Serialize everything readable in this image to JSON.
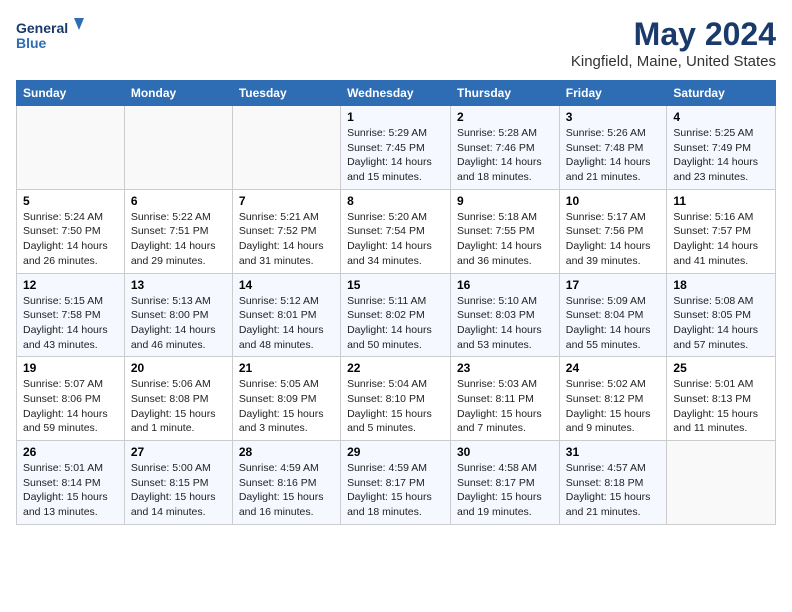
{
  "header": {
    "logo_line1": "General",
    "logo_line2": "Blue",
    "title": "May 2024",
    "subtitle": "Kingfield, Maine, United States"
  },
  "weekdays": [
    "Sunday",
    "Monday",
    "Tuesday",
    "Wednesday",
    "Thursday",
    "Friday",
    "Saturday"
  ],
  "weeks": [
    [
      {
        "day": "",
        "detail": ""
      },
      {
        "day": "",
        "detail": ""
      },
      {
        "day": "",
        "detail": ""
      },
      {
        "day": "1",
        "detail": "Sunrise: 5:29 AM\nSunset: 7:45 PM\nDaylight: 14 hours\nand 15 minutes."
      },
      {
        "day": "2",
        "detail": "Sunrise: 5:28 AM\nSunset: 7:46 PM\nDaylight: 14 hours\nand 18 minutes."
      },
      {
        "day": "3",
        "detail": "Sunrise: 5:26 AM\nSunset: 7:48 PM\nDaylight: 14 hours\nand 21 minutes."
      },
      {
        "day": "4",
        "detail": "Sunrise: 5:25 AM\nSunset: 7:49 PM\nDaylight: 14 hours\nand 23 minutes."
      }
    ],
    [
      {
        "day": "5",
        "detail": "Sunrise: 5:24 AM\nSunset: 7:50 PM\nDaylight: 14 hours\nand 26 minutes."
      },
      {
        "day": "6",
        "detail": "Sunrise: 5:22 AM\nSunset: 7:51 PM\nDaylight: 14 hours\nand 29 minutes."
      },
      {
        "day": "7",
        "detail": "Sunrise: 5:21 AM\nSunset: 7:52 PM\nDaylight: 14 hours\nand 31 minutes."
      },
      {
        "day": "8",
        "detail": "Sunrise: 5:20 AM\nSunset: 7:54 PM\nDaylight: 14 hours\nand 34 minutes."
      },
      {
        "day": "9",
        "detail": "Sunrise: 5:18 AM\nSunset: 7:55 PM\nDaylight: 14 hours\nand 36 minutes."
      },
      {
        "day": "10",
        "detail": "Sunrise: 5:17 AM\nSunset: 7:56 PM\nDaylight: 14 hours\nand 39 minutes."
      },
      {
        "day": "11",
        "detail": "Sunrise: 5:16 AM\nSunset: 7:57 PM\nDaylight: 14 hours\nand 41 minutes."
      }
    ],
    [
      {
        "day": "12",
        "detail": "Sunrise: 5:15 AM\nSunset: 7:58 PM\nDaylight: 14 hours\nand 43 minutes."
      },
      {
        "day": "13",
        "detail": "Sunrise: 5:13 AM\nSunset: 8:00 PM\nDaylight: 14 hours\nand 46 minutes."
      },
      {
        "day": "14",
        "detail": "Sunrise: 5:12 AM\nSunset: 8:01 PM\nDaylight: 14 hours\nand 48 minutes."
      },
      {
        "day": "15",
        "detail": "Sunrise: 5:11 AM\nSunset: 8:02 PM\nDaylight: 14 hours\nand 50 minutes."
      },
      {
        "day": "16",
        "detail": "Sunrise: 5:10 AM\nSunset: 8:03 PM\nDaylight: 14 hours\nand 53 minutes."
      },
      {
        "day": "17",
        "detail": "Sunrise: 5:09 AM\nSunset: 8:04 PM\nDaylight: 14 hours\nand 55 minutes."
      },
      {
        "day": "18",
        "detail": "Sunrise: 5:08 AM\nSunset: 8:05 PM\nDaylight: 14 hours\nand 57 minutes."
      }
    ],
    [
      {
        "day": "19",
        "detail": "Sunrise: 5:07 AM\nSunset: 8:06 PM\nDaylight: 14 hours\nand 59 minutes."
      },
      {
        "day": "20",
        "detail": "Sunrise: 5:06 AM\nSunset: 8:08 PM\nDaylight: 15 hours\nand 1 minute."
      },
      {
        "day": "21",
        "detail": "Sunrise: 5:05 AM\nSunset: 8:09 PM\nDaylight: 15 hours\nand 3 minutes."
      },
      {
        "day": "22",
        "detail": "Sunrise: 5:04 AM\nSunset: 8:10 PM\nDaylight: 15 hours\nand 5 minutes."
      },
      {
        "day": "23",
        "detail": "Sunrise: 5:03 AM\nSunset: 8:11 PM\nDaylight: 15 hours\nand 7 minutes."
      },
      {
        "day": "24",
        "detail": "Sunrise: 5:02 AM\nSunset: 8:12 PM\nDaylight: 15 hours\nand 9 minutes."
      },
      {
        "day": "25",
        "detail": "Sunrise: 5:01 AM\nSunset: 8:13 PM\nDaylight: 15 hours\nand 11 minutes."
      }
    ],
    [
      {
        "day": "26",
        "detail": "Sunrise: 5:01 AM\nSunset: 8:14 PM\nDaylight: 15 hours\nand 13 minutes."
      },
      {
        "day": "27",
        "detail": "Sunrise: 5:00 AM\nSunset: 8:15 PM\nDaylight: 15 hours\nand 14 minutes."
      },
      {
        "day": "28",
        "detail": "Sunrise: 4:59 AM\nSunset: 8:16 PM\nDaylight: 15 hours\nand 16 minutes."
      },
      {
        "day": "29",
        "detail": "Sunrise: 4:59 AM\nSunset: 8:17 PM\nDaylight: 15 hours\nand 18 minutes."
      },
      {
        "day": "30",
        "detail": "Sunrise: 4:58 AM\nSunset: 8:17 PM\nDaylight: 15 hours\nand 19 minutes."
      },
      {
        "day": "31",
        "detail": "Sunrise: 4:57 AM\nSunset: 8:18 PM\nDaylight: 15 hours\nand 21 minutes."
      },
      {
        "day": "",
        "detail": ""
      }
    ]
  ]
}
